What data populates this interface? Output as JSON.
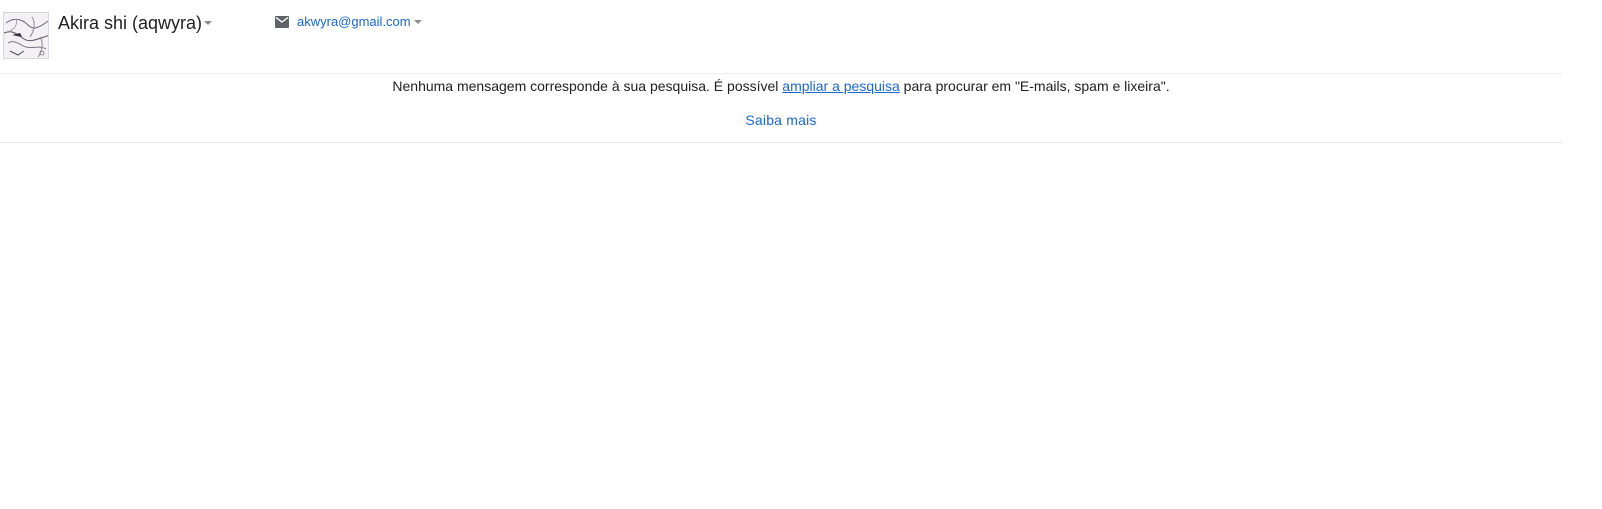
{
  "account": {
    "name": "Akira shi (aqwyra)",
    "email": "akwyra@gmail.com",
    "avatar_icon": "anime-avatar-image",
    "email_icon": "envelope-icon"
  },
  "search_result": {
    "message_before": "Nenhuma mensagem corresponde à sua pesquisa. É possível ",
    "expand_link": "ampliar a pesquisa",
    "message_after": " para procurar em \"E-mails, spam e lixeira\".",
    "learn_more": "Saiba mais"
  },
  "colors": {
    "link": "#1a67d2",
    "text": "#202124",
    "divider": "#eeeeee"
  }
}
